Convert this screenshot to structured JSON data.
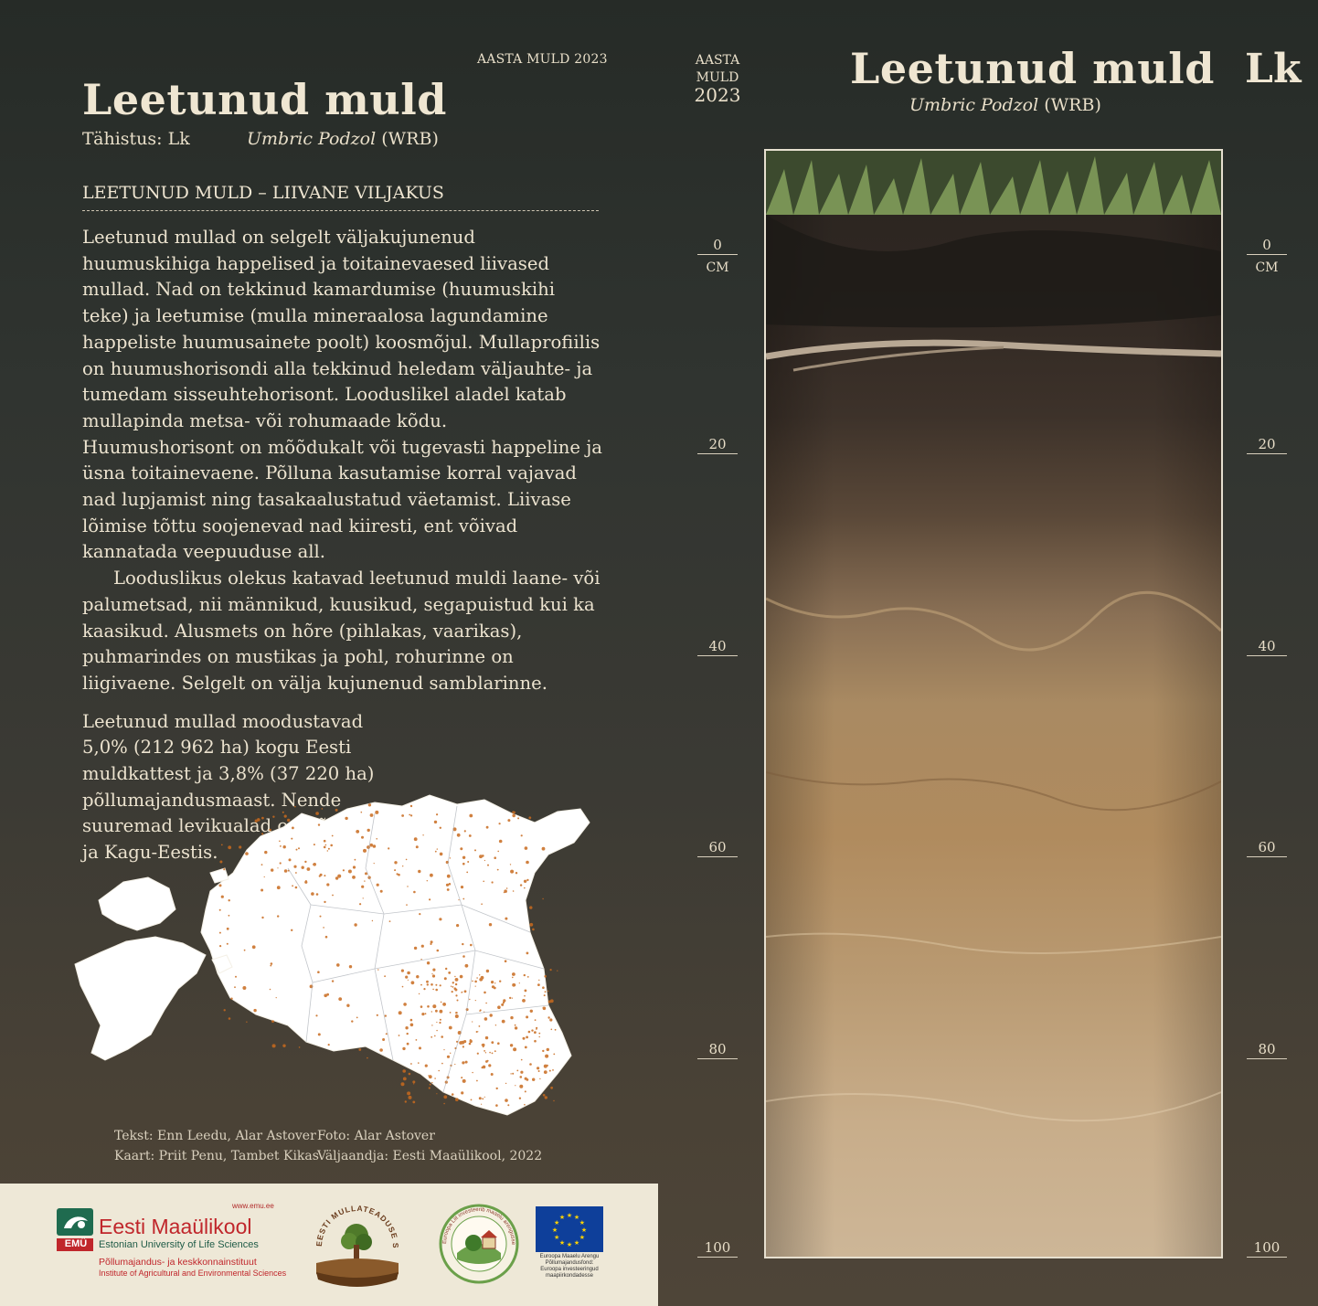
{
  "header": {
    "year_label": "AASTA MULD 2023",
    "title": "Leetunud muld",
    "designation": "Tähistus: Lk",
    "latin_name": "Umbric Podzol",
    "latin_suffix": "(WRB)"
  },
  "section_heading": "LEETUNUD MULD – LIIVANE VILJAKUS",
  "paragraphs": [
    "Leetunud mullad on selgelt väljakujunenud huumuskihiga happelised ja toitainevaesed liivased mullad. Nad on tekkinud kamardumise (huumuskihi teke) ja leetumise (mulla mineraalosa lagundamine happeliste huumusainete poolt) koosmõjul. Mullaprofiilis on huumushorisondi alla tekkinud heledam väljauhte- ja tumedam sisseuhtehorisont. Looduslikel aladel katab mullapinda metsa- või rohumaade kõdu. Huumushorisont on mõõdukalt või tugevasti happeline ja üsna toitainevaene. Põlluna kasutamise korral vajavad nad lupjamist ning tasakaalustatud väetamist. Liivase lõimise tõttu soojenevad nad kiiresti, ent võivad kannatada veepuuduse all.",
    "Looduslikus olekus katavad leetunud muldi laane- või palumetsad, nii männikud, kuusikud, segapuistud kui ka kaasikud. Alusmets on hõre (pihlakas, vaarikas), puhmarindes on mustikas ja pohl, rohurinne on liigivaene. Selgelt on välja kujunenud samblarinne.",
    "Leetunud mullad moodustavad 5,0% (212 962 ha) kogu Eesti muldkattest ja 3,8% (37 220 ha) põllumajandusmaast. Nende suuremad levikualad on Lõuna- ja Kagu-Eestis."
  ],
  "credits": {
    "text": "Tekst: Enn Leedu, Alar Astover",
    "photo": "Foto: Alar Astover",
    "map": "Kaart: Priit Penu, Tambet Kikas",
    "publisher": "Väljaandja:  Eesti Maaülikool, 2022"
  },
  "footer": {
    "emu_url": "www.emu.ee",
    "emu_name": "Eesti Maaülikool",
    "emu_abbr": "EMÜ",
    "emu_english": "Estonian University of Life Sciences",
    "institute_et": "Põllumajandus- ja keskkonnainstituut",
    "institute_en": "Institute of Agricultural and Environmental Sciences",
    "society_name": "EESTI MULLATEADUSE SELTS",
    "leader_text": "Euroopa Liit investeerib maaelu arengusse",
    "eu_text_1": "Euroopa Maaelu Arengu",
    "eu_text_2": "Põllumajandusfond:",
    "eu_text_3": "Euroopa investeeringud",
    "eu_text_4": "maapiirkondadesse"
  },
  "scale": {
    "head_1": "AASTA",
    "head_2": "MULD",
    "head_3": "2023",
    "unit": "CM",
    "ticks": [
      "0",
      "20",
      "40",
      "60",
      "80",
      "100"
    ]
  },
  "right": {
    "title": "Leetunud muld",
    "latin_name": "Umbric Podzol",
    "latin_suffix": "(WRB)",
    "code": "Lk"
  },
  "colors": {
    "background_top": "#262b27",
    "background_bottom": "#4e4538",
    "text": "#ece3cf",
    "footer": "#eee8d7",
    "emu_red": "#c0262b",
    "emu_green": "#1f5b47",
    "eu_blue": "#0e3f9a",
    "eu_star": "#ffd200",
    "map_dots": "#c86a1e"
  }
}
